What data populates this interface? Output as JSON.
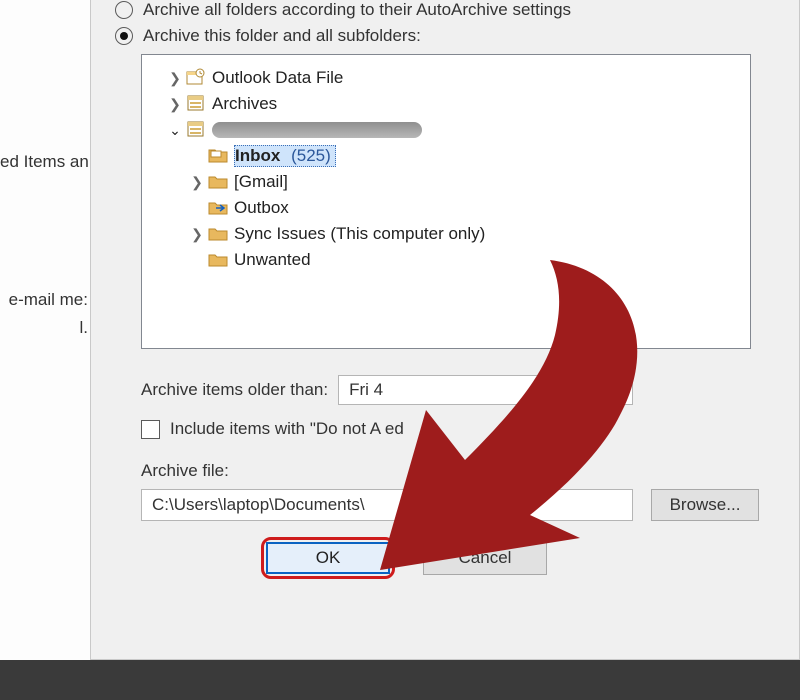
{
  "background": {
    "line1": "ed Items an",
    "line2": "e-mail me:",
    "line3": "l."
  },
  "dialog": {
    "radio1_label": "Archive all folders according to their AutoArchive settings",
    "radio2_label": "Archive this folder and all subfolders:",
    "tree": {
      "root1": "Outlook Data File",
      "root2": "Archives",
      "inbox": "Inbox",
      "inbox_count": "(525)",
      "gmail": "[Gmail]",
      "outbox": "Outbox",
      "sync": "Sync Issues (This computer only)",
      "unwanted": "Unwanted"
    },
    "older_label": "Archive items older than:",
    "older_value": "Fri 4",
    "include_label": "Include items with \"Do not A                                   ed",
    "archive_file_label": "Archive file:",
    "archive_file_value": "C:\\Users\\laptop\\Documents\\",
    "browse_label": "Browse...",
    "ok_label": "OK",
    "cancel_label": "Cancel"
  }
}
